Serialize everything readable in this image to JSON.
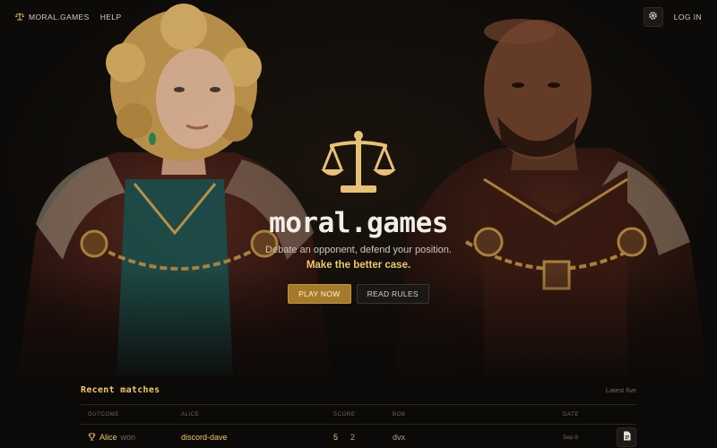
{
  "nav": {
    "brand": "MORAL.GAMES",
    "help": "HELP",
    "login": "LOG IN"
  },
  "hero": {
    "title": "moral.games",
    "tagline": "Debate an opponent, defend your position.",
    "emphasis": "Make the better case.",
    "play_label": "PLAY NOW",
    "rules_label": "READ RULES"
  },
  "matches": {
    "title": "Recent matches",
    "subtitle": "Latest five",
    "columns": [
      "OUTCOME",
      "ALICE",
      "SCORE",
      "BOB",
      "DATE"
    ],
    "rows": [
      {
        "winner": "Alice",
        "result": "won",
        "alice": "discord-dave",
        "score_alice": "5",
        "score_bob": "2",
        "bob": "dvx",
        "date": "Sep 8"
      }
    ]
  },
  "colors": {
    "accent": "#f0c86c",
    "button_primary": "#a57b2a",
    "background": "#0c0a08"
  },
  "icons": [
    "scales-icon",
    "gear-icon",
    "trophy-icon",
    "document-icon"
  ]
}
